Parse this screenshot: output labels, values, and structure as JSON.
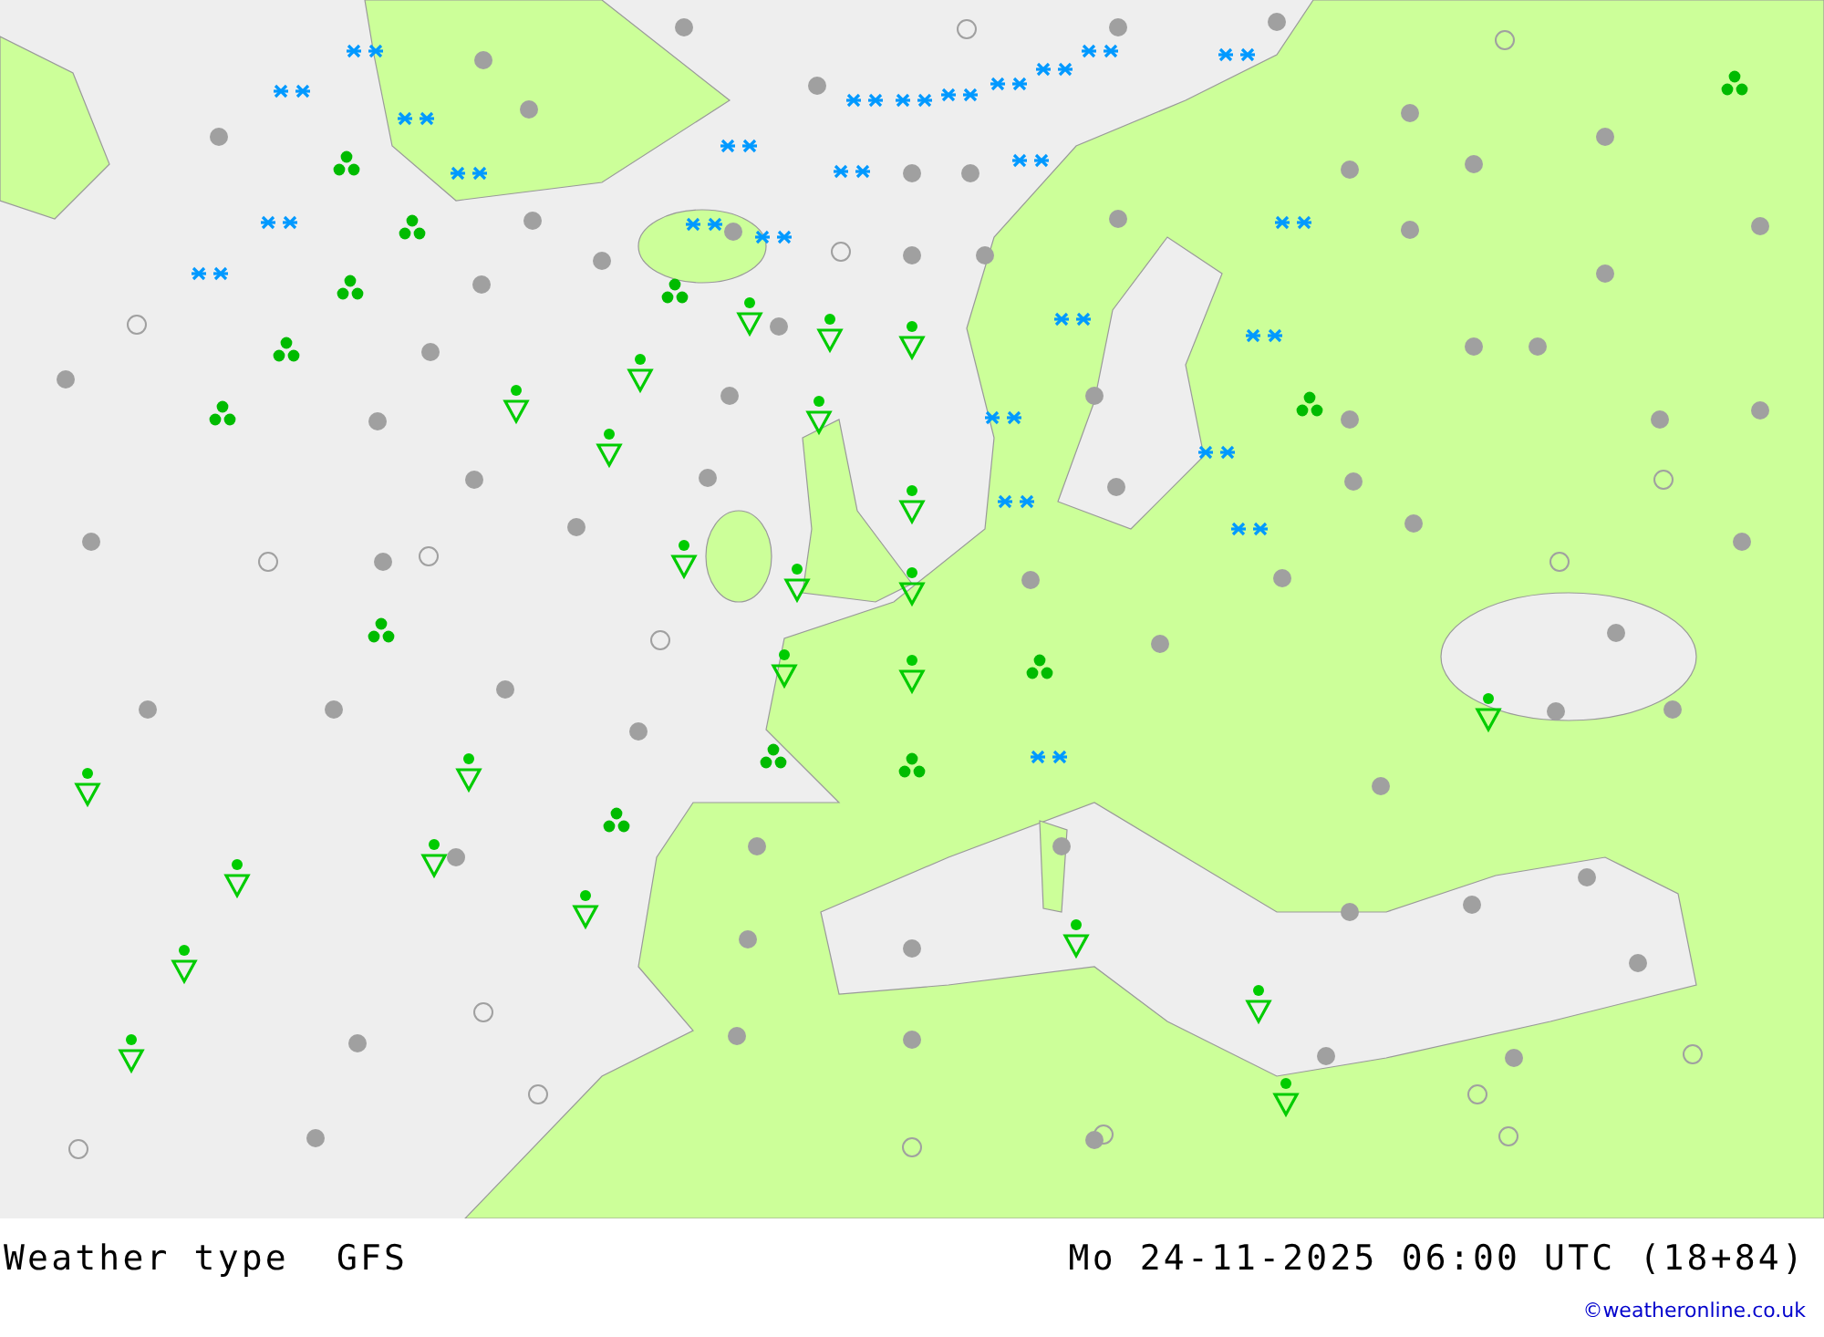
{
  "footer": {
    "title": "Weather type",
    "model": "GFS",
    "datetime": "Mo 24-11-2025 06:00 UTC (18+84)",
    "credit": "©weatheronline.co.uk"
  }
}
